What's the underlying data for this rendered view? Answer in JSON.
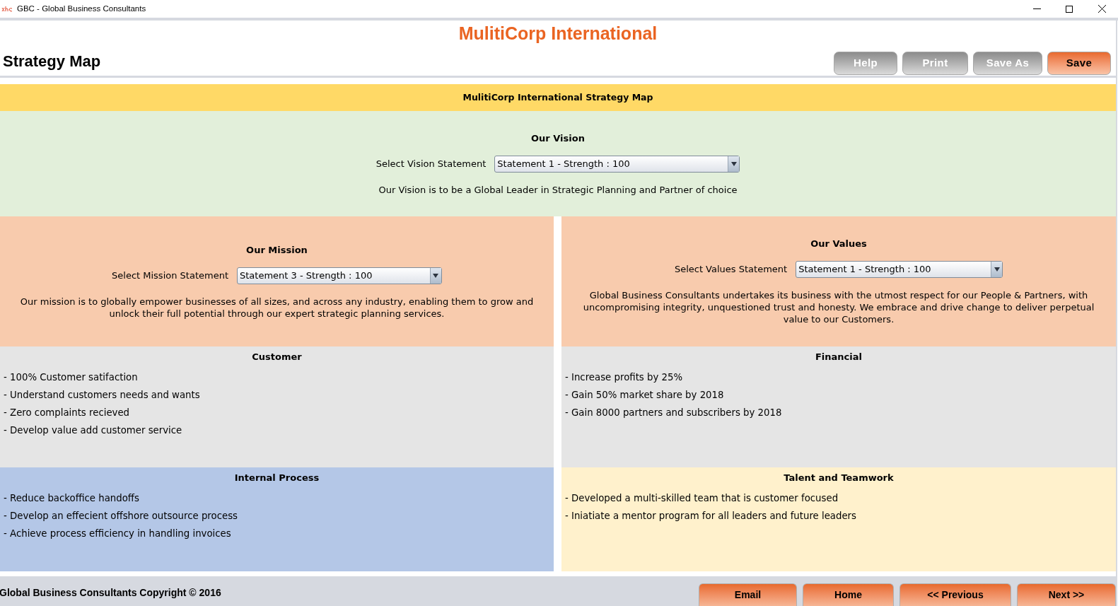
{
  "window": {
    "title": "GBC - Global Business Consultants"
  },
  "header": {
    "company": "MulitiCorp International",
    "page_title": "Strategy Map",
    "buttons": [
      {
        "label": "Help",
        "kind": "secondary"
      },
      {
        "label": "Print",
        "kind": "secondary"
      },
      {
        "label": "Save As",
        "kind": "secondary"
      },
      {
        "label": "Save",
        "kind": "primary"
      }
    ]
  },
  "map": {
    "title": "MulitiCorp International Strategy Map",
    "vision": {
      "heading": "Our Vision",
      "select_label": "Select Vision Statement",
      "select_value": "Statement 1 - Strength : 100",
      "text": "Our Vision is to be a Global Leader in Strategic Planning and Partner of choice"
    },
    "mission": {
      "heading": "Our Mission",
      "select_label": "Select Mission Statement",
      "select_value": "Statement 3 - Strength : 100",
      "text": "Our mission is to globally empower businesses of all sizes, and across any industry, enabling them to grow and unlock their full potential through our expert strategic planning services."
    },
    "values": {
      "heading": "Our Values",
      "select_label": "Select Values Statement",
      "select_value": "Statement 1 - Strength : 100",
      "text": "Global Business Consultants undertakes its business with the utmost respect for our People & Partners, with uncompromising integrity, unquestioned trust and honesty. We embrace and drive change to deliver perpetual value to our Customers."
    },
    "perspectives": [
      {
        "heading": "Customer",
        "color": "#e5e5e5",
        "items": [
          "- 100% Customer satifaction",
          "- Understand customers needs and wants",
          "- Zero complaints recieved",
          "- Develop value add customer service"
        ]
      },
      {
        "heading": "Financial",
        "color": "#e5e5e5",
        "items": [
          "- Increase profits by 25%",
          "- Gain 50% market share by 2018",
          "- Gain 8000 partners and subscribers by 2018"
        ]
      },
      {
        "heading": "Internal Process",
        "color": "#b4c7e7",
        "items": [
          "- Reduce backoffice handoffs",
          "- Develop an effecient offshore outsource process",
          "- Achieve process efficiency in handling invoices"
        ]
      },
      {
        "heading": "Talent and Teamwork",
        "color": "#fff1cc",
        "items": [
          "- Developed a multi-skilled team that is customer focused",
          "- Iniatiate a mentor program for all leaders and future leaders"
        ]
      }
    ]
  },
  "footer": {
    "copyright": "Global Business Consultants Copyright © 2016",
    "buttons": [
      "Email",
      "Home",
      "<< Previous",
      "Next >>"
    ]
  }
}
